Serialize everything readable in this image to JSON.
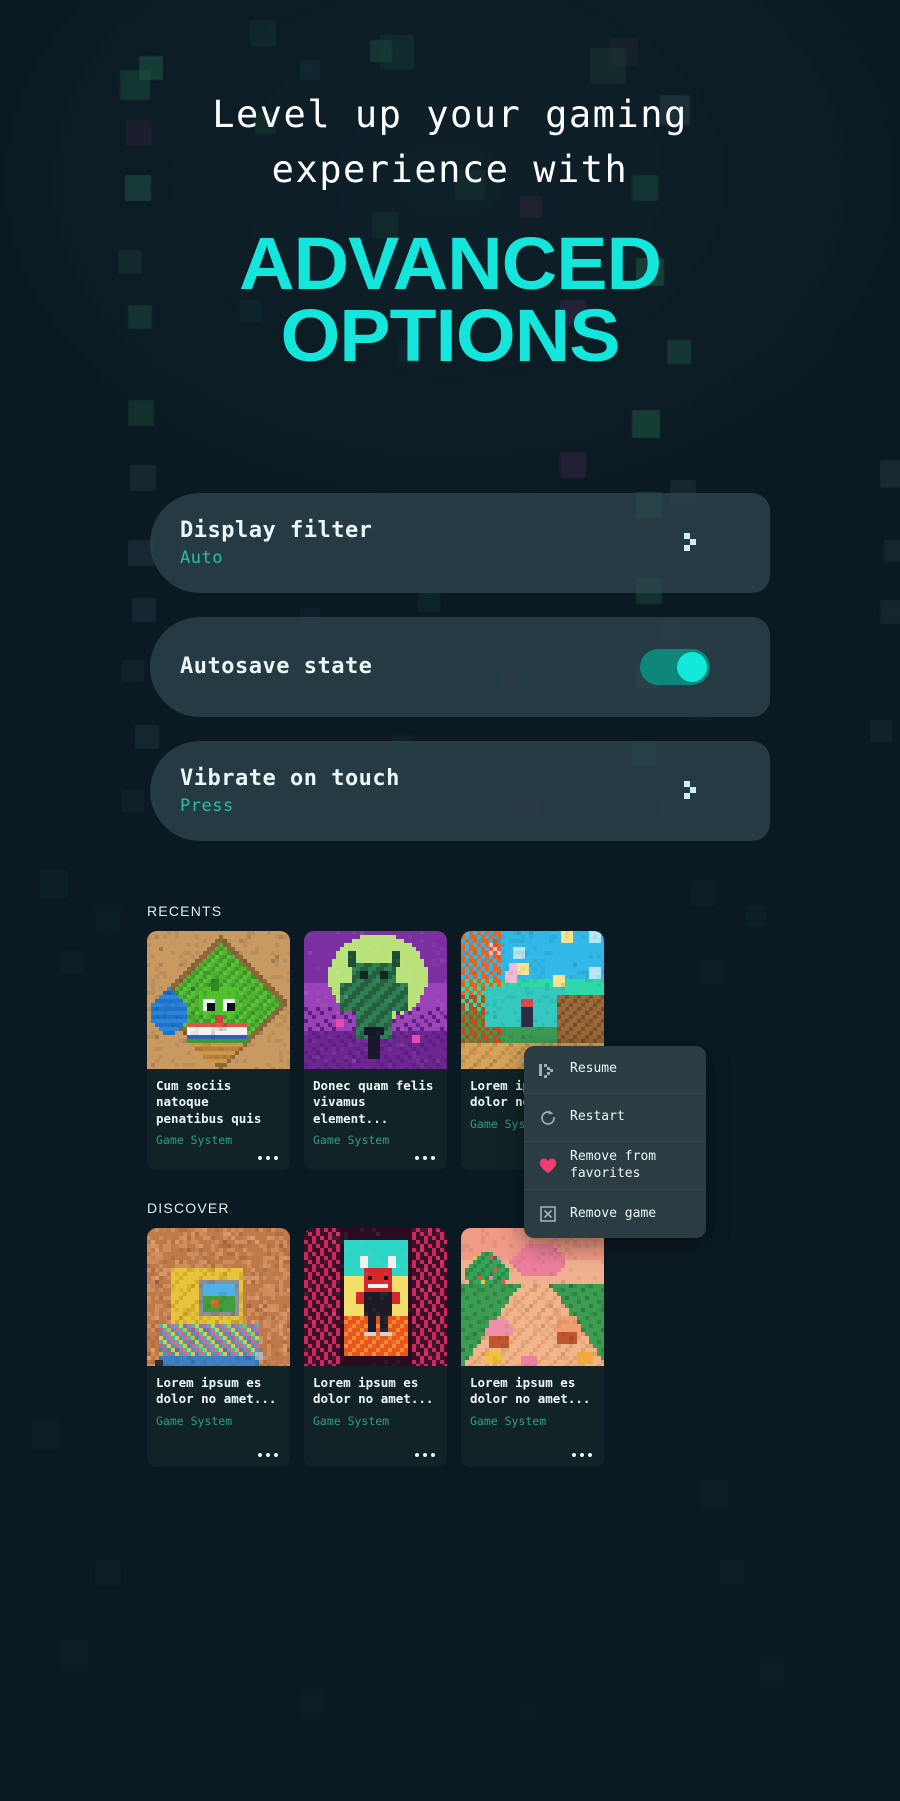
{
  "hero": {
    "line1": "Level up your gaming",
    "line2": "experience with",
    "big1": "ADVANCED",
    "big2": "OPTIONS",
    "accent_color": "#15e6dc",
    "text_color": "#ffffff"
  },
  "settings": [
    {
      "title": "Display filter",
      "value": "Auto",
      "control": "chevron",
      "icon": "chevron-right-icon"
    },
    {
      "title": "Autosave state",
      "value": "",
      "control": "toggle",
      "toggle_on": true,
      "toggle_track_color": "#0e8679",
      "toggle_knob_color": "#12e9d8"
    },
    {
      "title": "Vibrate on touch",
      "value": "Press",
      "control": "chevron",
      "icon": "chevron-right-icon"
    }
  ],
  "library": {
    "sections": [
      {
        "label": "RECENTS",
        "cards": [
          {
            "title": "Cum sociis natoque penatibus quis",
            "system": "Game System",
            "art": "frog-cupcake-meadow"
          },
          {
            "title": "Donec quam felis vivamus element...",
            "system": "Game System",
            "art": "purple-golem-moon"
          },
          {
            "title": "Lorem ipsum es dolor no amet...",
            "system": "Game System",
            "art": "autumn-river-village"
          }
        ]
      },
      {
        "label": "DISCOVER",
        "cards": [
          {
            "title": "Lorem ipsum es dolor no amet...",
            "system": "Game System",
            "art": "retro-console-blocks"
          },
          {
            "title": "Lorem ipsum es dolor no amet...",
            "system": "Game System",
            "art": "red-demon-arcade"
          },
          {
            "title": "Lorem ipsum es dolor no amet...",
            "system": "Game System",
            "art": "candy-orchard-path"
          }
        ]
      }
    ],
    "system_color": "#2f9e84",
    "more_icon": "ellipsis-icon"
  },
  "context_menu": {
    "items": [
      {
        "label": "Resume",
        "icon": "play-icon"
      },
      {
        "label": "Restart",
        "icon": "restart-icon"
      },
      {
        "label": "Remove from favorites",
        "icon": "heart-icon"
      },
      {
        "label": "Remove game",
        "icon": "remove-box-icon"
      }
    ],
    "background_color": "#2c3c43",
    "heart_color": "#ef3d6e"
  },
  "background": {
    "base_color": "#0b1a22",
    "square_colors": [
      "#13453a",
      "#1d5a46",
      "#2a2033",
      "#3b2b48",
      "#26383f",
      "#17323a"
    ]
  }
}
